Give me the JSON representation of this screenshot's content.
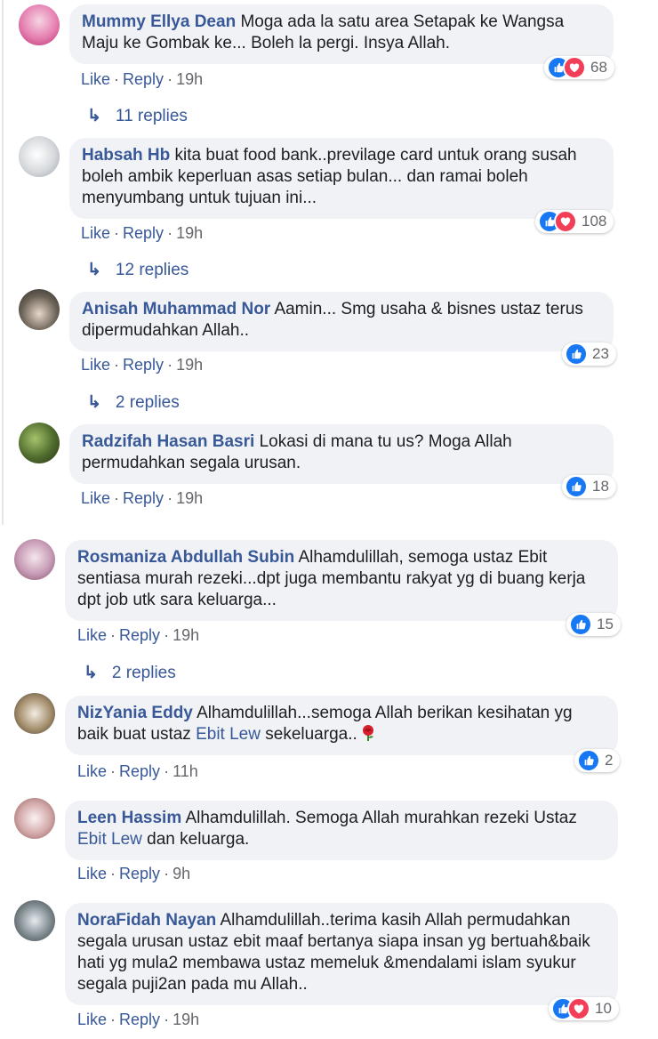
{
  "actions": {
    "like": "Like",
    "reply": "Reply",
    "separator": "·"
  },
  "comments": [
    {
      "author": "Mummy Ellya Dean",
      "text": "Moga ada la satu area Setapak ke Wangsa Maju ke Gombak ke... Boleh la pergi. Insya Allah.",
      "time": "19h",
      "reactions": "68",
      "replies": "11 replies"
    },
    {
      "author": "Habsah Hb",
      "text": "kita buat food bank..previlage card untuk orang susah boleh ambik keperluan asas setiap bulan... dan ramai boleh menyumbang untuk tujuan ini...",
      "time": "19h",
      "reactions": "108",
      "replies": "12 replies"
    },
    {
      "author": "Anisah Muhammad Nor",
      "text": "Aamin... Smg usaha & bisnes ustaz terus dipermudahkan Allah..",
      "time": "19h",
      "reactions": "23",
      "replies": "2 replies"
    },
    {
      "author": "Radzifah Hasan Basri",
      "text": "Lokasi di mana tu us? Moga Allah permudahkan segala urusan.",
      "time": "19h",
      "reactions": "18"
    },
    {
      "author": "Rosmaniza Abdullah Subin",
      "text": "Alhamdulillah, semoga ustaz Ebit sentiasa murah rezeki...dpt juga membantu rakyat yg di buang kerja dpt job utk sara keluarga...",
      "time": "19h",
      "reactions": "15",
      "replies": "2 replies"
    },
    {
      "author": "NizYania Eddy",
      "text_before": "Alhamdulillah...semoga Allah berikan kesihatan yg baik buat ustaz",
      "mention": "Ebit Lew",
      "text_after": "sekeluarga..",
      "time": "11h",
      "reactions": "2"
    },
    {
      "author": "Leen Hassim",
      "text_before": "Alhamdulillah. Semoga Allah murahkan rezeki Ustaz",
      "mention": "Ebit Lew",
      "text_after": "dan keluarga.",
      "time": "9h"
    },
    {
      "author": "NoraFidah Nayan",
      "text": "Alhamdulillah..terima kasih Allah permudahkan segala urusan ustaz ebit maaf bertanya siapa insan yg bertuah&baik hati yg mula2 membawa ustaz memeluk &mendalami islam syukur segala puji2an pada mu Allah..",
      "time": "19h",
      "reactions": "10"
    }
  ],
  "icons": {
    "like": "thumbs-up-icon",
    "love": "heart-icon",
    "reply_arrow": "reply-arrow-icon",
    "rose": "rose-icon"
  },
  "colors": {
    "link": "#385898",
    "bubble": "#f0f2f5",
    "meta": "#65676b",
    "like": "#1877f2",
    "love": "#f33e58"
  }
}
